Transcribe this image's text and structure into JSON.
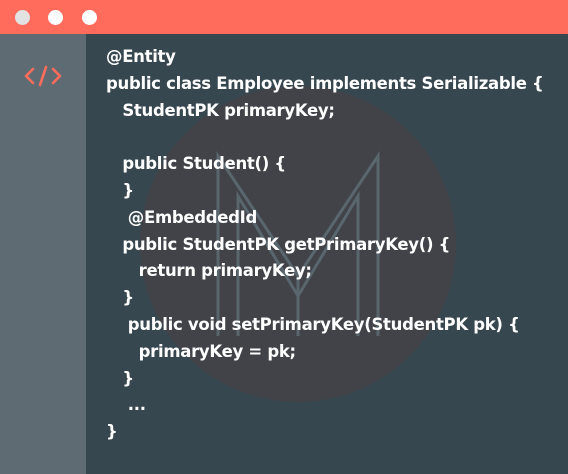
{
  "window": {
    "colors": {
      "titlebar": "#ff6c5c",
      "editor_bg": "#37474f",
      "gutter_bg": "#5f6b72",
      "icon": "#ff6c5c",
      "text": "#ffffff"
    },
    "controls": [
      "circle",
      "circle",
      "circle"
    ]
  },
  "gutter": {
    "icon": "code-brackets-icon"
  },
  "code": {
    "language": "Java",
    "lines": [
      "@Entity",
      "public class Employee implements Serializable {",
      "   StudentPK primaryKey;",
      "",
      "   public Student() {",
      "   }",
      "    @EmbeddedId",
      "   public StudentPK getPrimaryKey() {",
      "      return primaryKey;",
      "   }",
      "    public void setPrimaryKey(StudentPK pk) {",
      "      primaryKey = pk;",
      "   }",
      "    ...",
      "}"
    ]
  },
  "watermark": {
    "icon": "m-logo-watermark"
  }
}
